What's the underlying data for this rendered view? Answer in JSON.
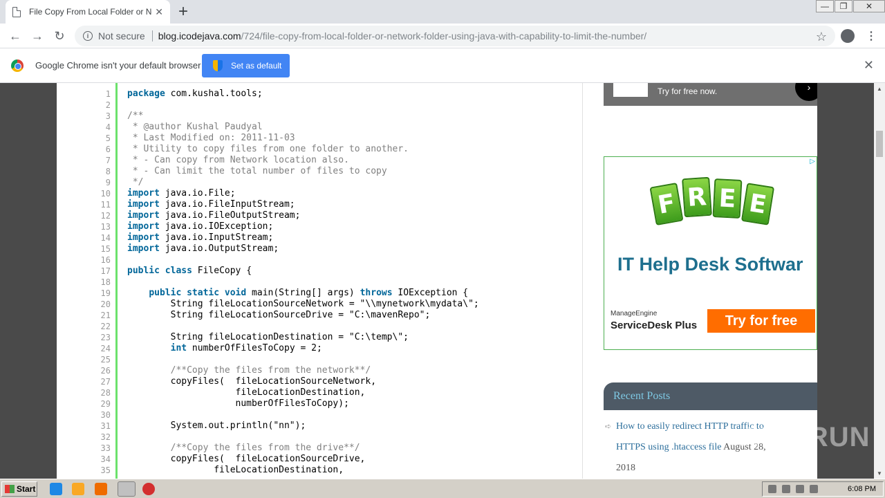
{
  "browser": {
    "tab_title": "File Copy From Local Folder or Network",
    "tab_close": "✕",
    "new_tab": "+",
    "window_buttons": [
      "—",
      "❐",
      "✕"
    ],
    "nav": {
      "back": "←",
      "forward": "→",
      "reload": "↻"
    },
    "not_secure": "Not secure",
    "url_host": "blog.icodejava.com",
    "url_path": "/724/file-copy-from-local-folder-or-network-folder-using-java-with-capability-to-limit-the-number/",
    "star": "☆",
    "menu": "⋮"
  },
  "infobar": {
    "message": "Google Chrome isn't your default browser",
    "button": "Set as default",
    "close": "✕"
  },
  "code": {
    "line_numbers": [
      "1",
      "2",
      "3",
      "4",
      "5",
      "6",
      "7",
      "8",
      "9",
      "10",
      "11",
      "12",
      "13",
      "14",
      "15",
      "16",
      "17",
      "18",
      "19",
      "20",
      "21",
      "22",
      "23",
      "24",
      "25",
      "26",
      "27",
      "28",
      "29",
      "30",
      "31",
      "32",
      "33",
      "34",
      "35"
    ],
    "lines": [
      "package com.kushal.tools;",
      "",
      "/**",
      " * @author Kushal Paudyal",
      " * Last Modified on: 2011-11-03",
      " * Utility to copy files from one folder to another.",
      " * - Can copy from Network location also.",
      " * - Can limit the total number of files to copy",
      " */",
      "import java.io.File;",
      "import java.io.FileInputStream;",
      "import java.io.FileOutputStream;",
      "import java.io.IOException;",
      "import java.io.InputStream;",
      "import java.io.OutputStream;",
      "",
      "public class FileCopy {",
      "",
      "    public static void main(String[] args) throws IOException {",
      "        String fileLocationSourceNetwork = \"\\\\mynetwork\\mydata\\\";",
      "        String fileLocationSourceDrive = \"C:\\mavenRepo\";",
      "",
      "        String fileLocationDestination = \"C:\\temp\\\";",
      "        int numberOfFilesToCopy = 2;",
      "",
      "        /**Copy the files from the network**/",
      "        copyFiles(  fileLocationSourceNetwork,",
      "                    fileLocationDestination,",
      "                    numberOfFilesToCopy);",
      "",
      "        System.out.println(\"nn\");",
      "",
      "        /**Copy the files from the drive**/",
      "        copyFiles(  fileLocationSourceDrive,",
      "                fileLocationDestination,"
    ]
  },
  "sidebar": {
    "ad_top_text": "Try for free now.",
    "ad_main": {
      "tag_letters": [
        "F",
        "R",
        "E",
        "E"
      ],
      "headline": "IT Help Desk Softwar",
      "brand_line1": "ManageEngine",
      "brand_line2": "ServiceDesk Plus",
      "cta": "Try for free"
    },
    "recent_posts_title": "Recent Posts",
    "recent_posts": [
      {
        "link": "How to easily redirect HTTP traffic to HTTPS using .htaccess file",
        "date": "August 28, 2018"
      }
    ],
    "recent_line1": "How to easily redirect HTTP traffic to",
    "recent_line2_link": "HTTPS using .htaccess file",
    "recent_line2_date": " August 28,",
    "recent_line3": "2018"
  },
  "watermark": "ANY RUN",
  "taskbar": {
    "start": "Start",
    "clock": "6:08 PM"
  }
}
